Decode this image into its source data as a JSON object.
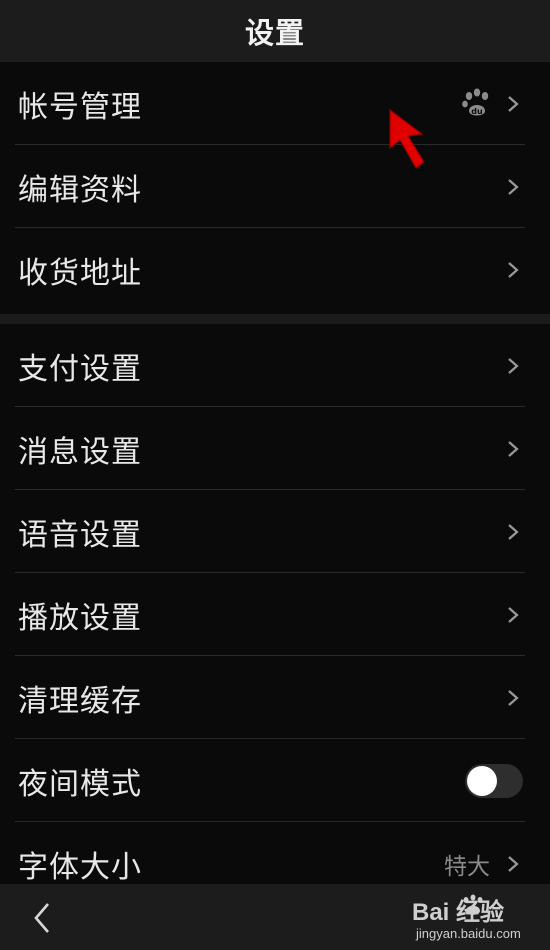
{
  "header": {
    "title": "设置"
  },
  "groups": [
    {
      "items": [
        {
          "label": "帐号管理",
          "badge_icon": "baidu-paw-icon"
        },
        {
          "label": "编辑资料"
        },
        {
          "label": "收货地址"
        }
      ]
    },
    {
      "items": [
        {
          "label": "支付设置"
        },
        {
          "label": "消息设置"
        },
        {
          "label": "语音设置"
        },
        {
          "label": "播放设置"
        },
        {
          "label": "清理缓存"
        },
        {
          "label": "夜间模式",
          "toggle": false
        },
        {
          "label": "字体大小",
          "value": "特大"
        }
      ]
    }
  ],
  "footer": {
    "back_icon": "chevron-left-icon",
    "watermark": {
      "brand": "Bai  经验",
      "url": "jingyan.baidu.com"
    }
  },
  "annotation": {
    "icon": "red-pointer-arrow",
    "color": "#e00000"
  },
  "colors": {
    "background": "#0a0a0a",
    "bar": "#1c1c1c",
    "text": "#e8e8e8",
    "secondary": "#8a8a8a"
  }
}
